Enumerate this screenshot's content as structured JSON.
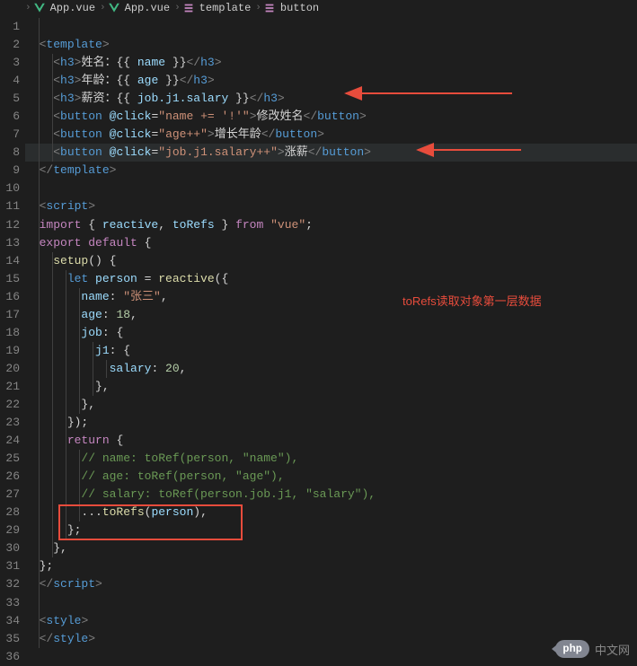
{
  "breadcrumb": {
    "item1": "App.vue",
    "item2": "App.vue",
    "item3": "template",
    "item4": "button"
  },
  "code": {
    "line1": "",
    "line2": {
      "tag_open": "<",
      "elem": "template",
      "tag_close": ">"
    },
    "line3": {
      "open": "<",
      "elem": "h3",
      "close": ">",
      "text": "姓名：",
      "mo": "{{ ",
      "var": "name",
      "mc": " }}",
      "eo": "</",
      "ee": "h3",
      "ec": ">"
    },
    "line4": {
      "open": "<",
      "elem": "h3",
      "close": ">",
      "text": "年龄：",
      "mo": "{{ ",
      "var": "age",
      "mc": " }}",
      "eo": "</",
      "ee": "h3",
      "ec": ">"
    },
    "line5": {
      "open": "<",
      "elem": "h3",
      "close": ">",
      "text": "薪资：",
      "mo": "{{ ",
      "var": "job.j1.salary",
      "mc": " }}",
      "eo": "</",
      "ee": "h3",
      "ec": ">"
    },
    "line6": {
      "open": "<",
      "elem": "button",
      "attr": " @click",
      "eq": "=",
      "val": "\"name += '!'\"",
      "close": ">",
      "text": "修改姓名",
      "eo": "</",
      "ee": "button",
      "ec": ">"
    },
    "line7": {
      "open": "<",
      "elem": "button",
      "attr": " @click",
      "eq": "=",
      "val": "\"age++\"",
      "close": ">",
      "text": "增长年龄",
      "eo": "</",
      "ee": "button",
      "ec": ">"
    },
    "line8": {
      "open": "<",
      "elem": "button",
      "attr": " @click",
      "eq": "=",
      "val": "\"job.j1.salary++\"",
      "close": ">",
      "text": "涨薪",
      "eo": "</",
      "ee": "button",
      "ec": ">"
    },
    "line9": {
      "open": "</",
      "elem": "template",
      "close": ">"
    },
    "line10": "",
    "line11": {
      "open": "<",
      "elem": "script",
      "close": ">"
    },
    "line12": {
      "kw1": "import",
      "p1": " { ",
      "v1": "reactive",
      "c": ", ",
      "v2": "toRefs",
      "p2": " } ",
      "kw2": "from",
      "sp": " ",
      "str": "\"vue\"",
      "sc": ";"
    },
    "line13": {
      "kw1": "export",
      "sp1": " ",
      "kw2": "default",
      "sp2": " ",
      "br": "{"
    },
    "line14": {
      "fn": "setup",
      "p": "() {"
    },
    "line15": {
      "kw": "let",
      "sp": " ",
      "v": "person",
      "eq": " = ",
      "fn": "reactive",
      "p": "({"
    },
    "line16": {
      "k": "name",
      "c": ": ",
      "v": "\"张三\"",
      "e": ","
    },
    "line17": {
      "k": "age",
      "c": ": ",
      "v": "18",
      "e": ","
    },
    "line18": {
      "k": "job",
      "c": ": ",
      "b": "{"
    },
    "line19": {
      "k": "j1",
      "c": ": ",
      "b": "{"
    },
    "line20": {
      "k": "salary",
      "c": ": ",
      "v": "20",
      "e": ","
    },
    "line21": {
      "b": "},"
    },
    "line22": {
      "b": "},"
    },
    "line23": {
      "b": "});"
    },
    "line24": {
      "kw": "return",
      "sp": " ",
      "b": "{"
    },
    "line25": {
      "cmt": "// name: toRef(person, \"name\"),"
    },
    "line26": {
      "cmt": "// age: toRef(person, \"age\"),"
    },
    "line27": {
      "cmt": "// salary: toRef(person.job.j1, \"salary\"),"
    },
    "line28": {
      "sp": "...",
      "fn": "toRefs",
      "po": "(",
      "v": "person",
      "pc": "),"
    },
    "line29": {
      "b": "};"
    },
    "line30": {
      "b": "},"
    },
    "line31": {
      "b": "};"
    },
    "line32": {
      "open": "</",
      "elem": "script",
      "close": ">"
    },
    "line33": "",
    "line34": {
      "open": "<",
      "elem": "style",
      "close": ">"
    },
    "line35": {
      "open": "</",
      "elem": "style",
      "close": ">"
    }
  },
  "annotation": {
    "text": "toRefs读取对象第一层数据"
  },
  "watermark": {
    "logo": "php",
    "text": "中文网"
  },
  "line_numbers": [
    1,
    2,
    3,
    4,
    5,
    6,
    7,
    8,
    9,
    10,
    11,
    12,
    13,
    14,
    15,
    16,
    17,
    18,
    19,
    20,
    21,
    22,
    23,
    24,
    25,
    26,
    27,
    28,
    29,
    30,
    31,
    32,
    33,
    34,
    35,
    36
  ]
}
